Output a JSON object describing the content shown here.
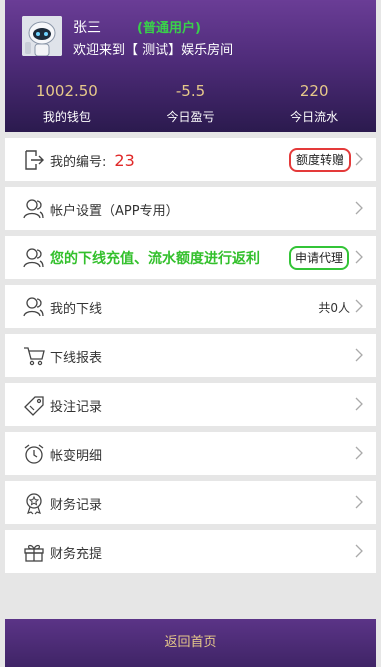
{
  "header": {
    "username": "张三",
    "user_type": "(普通用户)",
    "welcome": "欢迎来到【 测试】娱乐房间",
    "stats": [
      {
        "value": "1002.50",
        "label": "我的钱包"
      },
      {
        "value": "-5.5",
        "label": "今日盈亏"
      },
      {
        "value": "220",
        "label": "今日流水"
      }
    ]
  },
  "menu": {
    "my_number_label": "我的编号:",
    "my_number_value": "23",
    "transfer_button": "额度转赠",
    "account_settings": "帐户设置（APP专用）",
    "promo_text": "您的下线充值、流水额度进行返利",
    "apply_agent_button": "申请代理",
    "my_downline": "我的下线",
    "downline_count": "共0人",
    "downline_report": "下线报表",
    "bet_records": "投注记录",
    "account_changes": "帐变明细",
    "finance_records": "财务记录",
    "finance_recharge": "财务充提"
  },
  "footer": {
    "back_home": "返回首页"
  }
}
